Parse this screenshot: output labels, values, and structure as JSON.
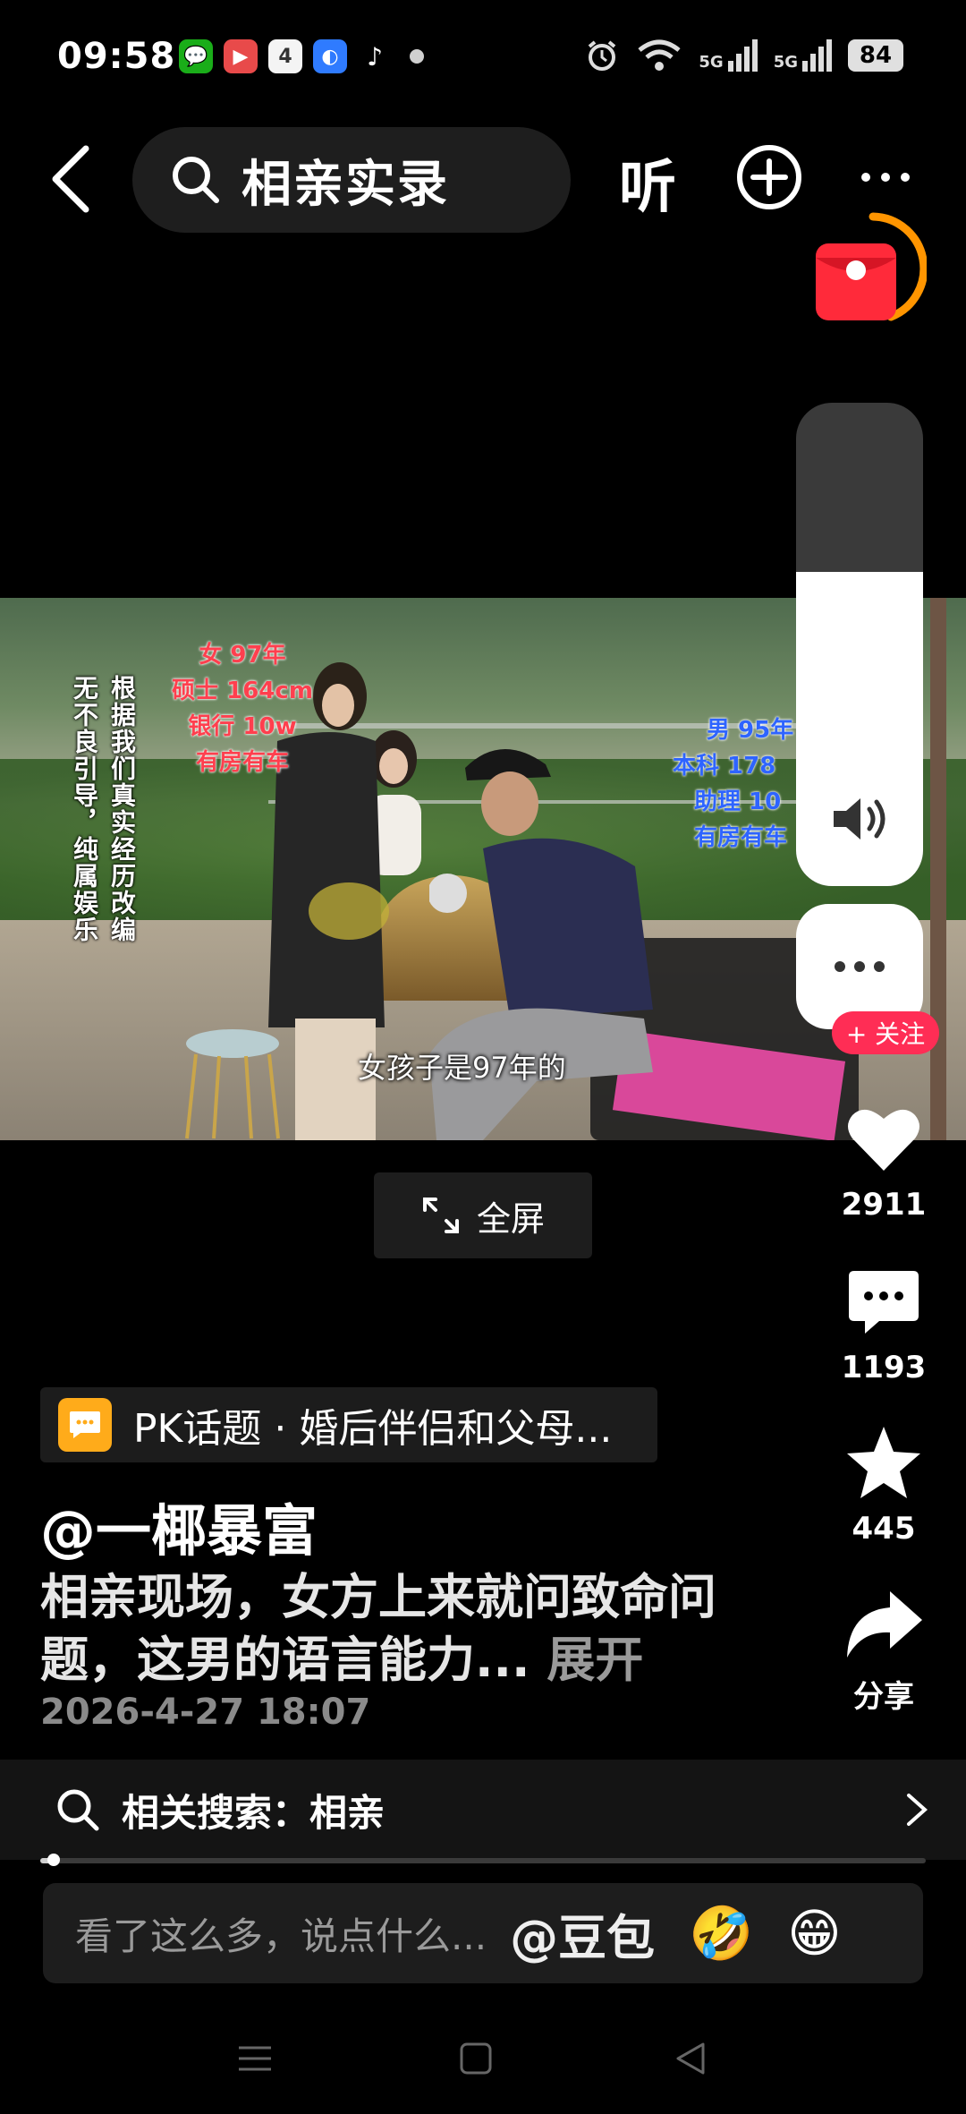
{
  "status_bar": {
    "time": "09:58",
    "notification_apps": [
      "wechat-icon",
      "video-app-icon",
      "calendar-icon",
      "browser-icon",
      "tiktok-icon"
    ],
    "calendar_day": "4",
    "battery": "84",
    "signal_labels": [
      "5G",
      "5G"
    ]
  },
  "top_bar": {
    "search_query": "相亲实录",
    "listen_label": "听"
  },
  "video": {
    "vertical_note": [
      "根据我们真实经历改编",
      "无不良引导，纯属娱乐"
    ],
    "female_info": [
      "女 97年",
      "硕士 164cm",
      "银行 10w",
      "有房有车"
    ],
    "male_info": [
      "男 95年",
      "本科 178",
      "助理 10",
      "有房有车"
    ],
    "subtitle": "女孩子是97年的",
    "fullscreen_label": "全屏",
    "volume_level": 0.65
  },
  "actions": {
    "follow_label": "+ 关注",
    "likes": "2911",
    "comments": "1193",
    "favorites": "445",
    "share_label": "分享"
  },
  "post": {
    "pk_topic": "PK话题 · 婚后伴侣和父母...",
    "author": "@一椰暴富",
    "description": "相亲现场，女方上来就问致命问题，这男的语言能力...",
    "expand_label": "展开",
    "date": "2026-4-27 18:07"
  },
  "related": {
    "label": "相关搜索：相亲"
  },
  "playback": {
    "progress": 0.015
  },
  "comment_bar": {
    "placeholder": "看了这么多，说点什么...",
    "at_label": "@豆包",
    "emojis": [
      "🤣",
      "😁"
    ]
  },
  "colors": {
    "accent_red": "#ff2d55",
    "pk_orange": "#ffab1a",
    "timer_ring": "#ff9500"
  }
}
